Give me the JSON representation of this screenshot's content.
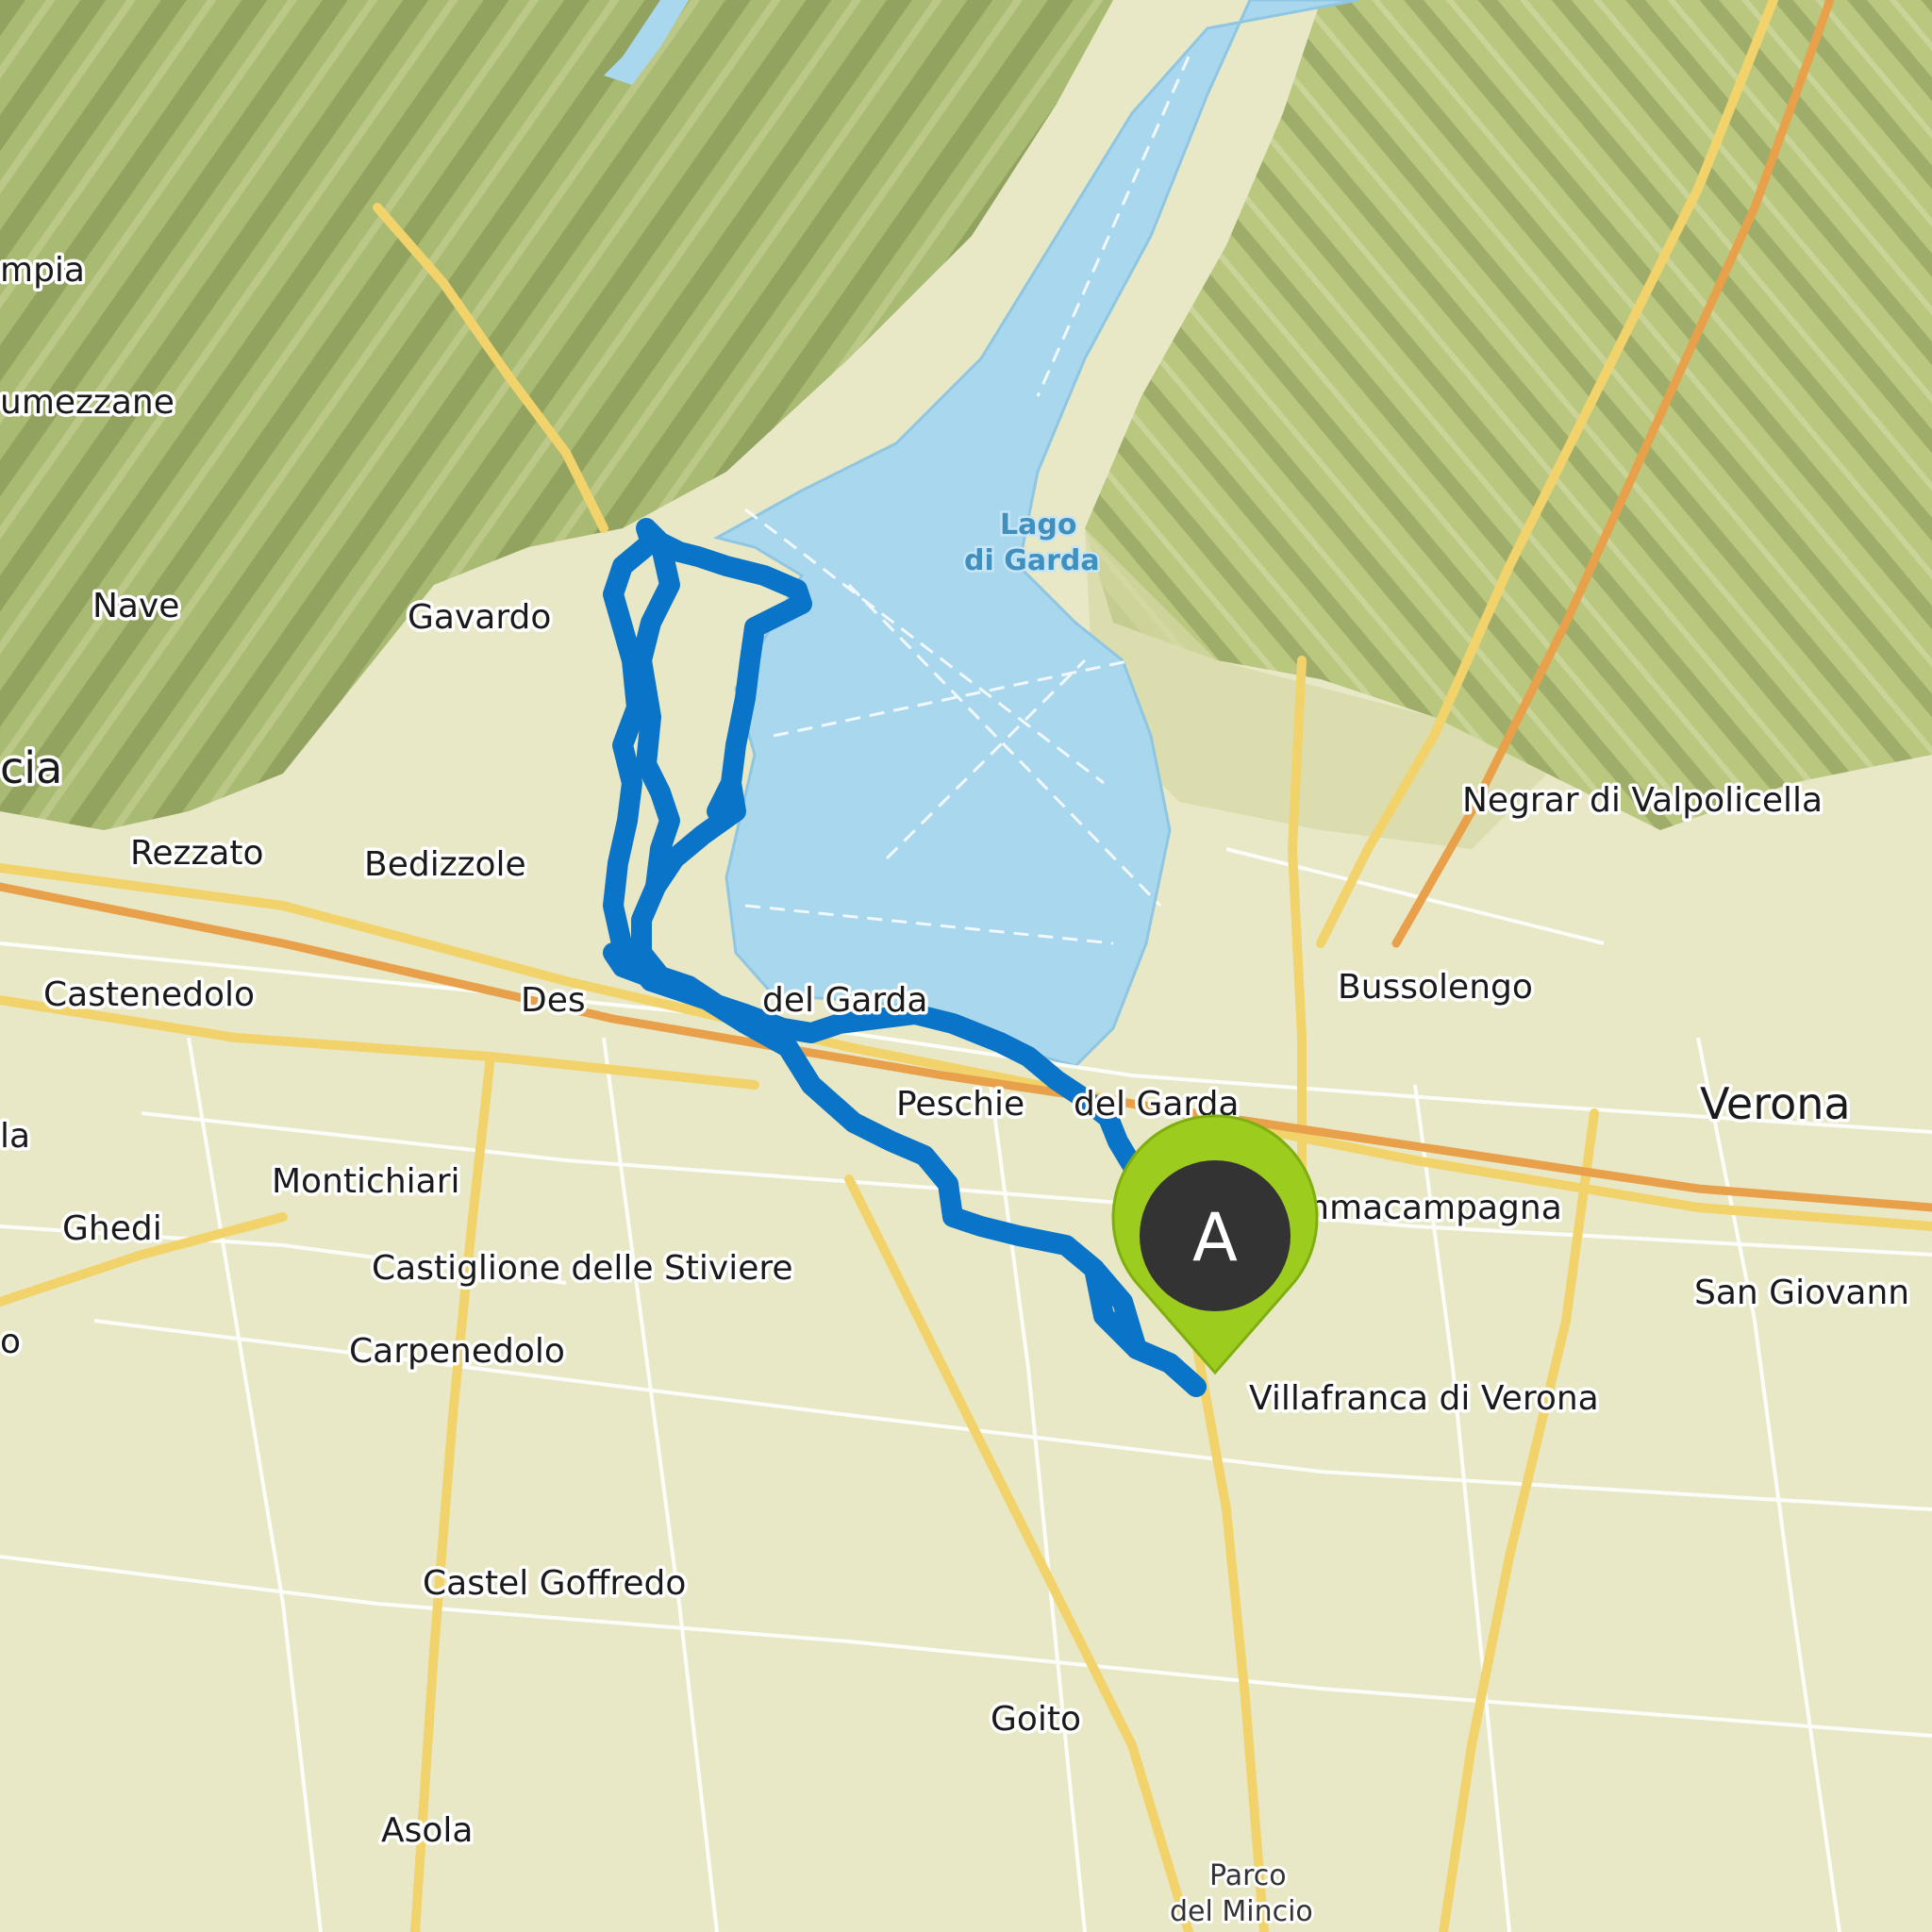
{
  "map": {
    "lake": {
      "line1": "Lago",
      "line2": "di Garda"
    },
    "places": {
      "lumezzane": "umezzane",
      "valtrompia": "mpia",
      "nave": "Nave",
      "gavardo": "Gavardo",
      "brescia": "cia",
      "rezzato": "Rezzato",
      "bedizzole": "Bedizzole",
      "castenedolo": "Castenedolo",
      "desenzano_part1": "Des",
      "desenzano_part2": "del Garda",
      "peschiera_part1": "Peschie",
      "peschiera_part2": "del Garda",
      "montichiari": "Montichiari",
      "ghedi": "Ghedi",
      "castiglione": "Castiglione delle Stiviere",
      "carpenedolo": "Carpenedolo",
      "castel_goffredo": "Castel Goffredo",
      "goito": "Goito",
      "asola": "Asola",
      "parco_line1": "Parco",
      "parco_line2": "del Mincio",
      "negrar": "Negrar di Valpolicella",
      "bussolengo": "Bussolengo",
      "verona": "Verona",
      "sommacampagna": "mmacampagna",
      "san_giovanni": "San Giovann",
      "villafranca": "Villafranca di Verona",
      "edge_la": "la",
      "edge_o": "o"
    },
    "start_marker": {
      "letter": "A"
    },
    "colors": {
      "route": "#0a74c9",
      "marker_ring": "#9ccd1e",
      "marker_body": "#333333",
      "lake": "#a9d7ee",
      "highway": "#f2d36b",
      "terrain": "#a7bb70"
    }
  }
}
